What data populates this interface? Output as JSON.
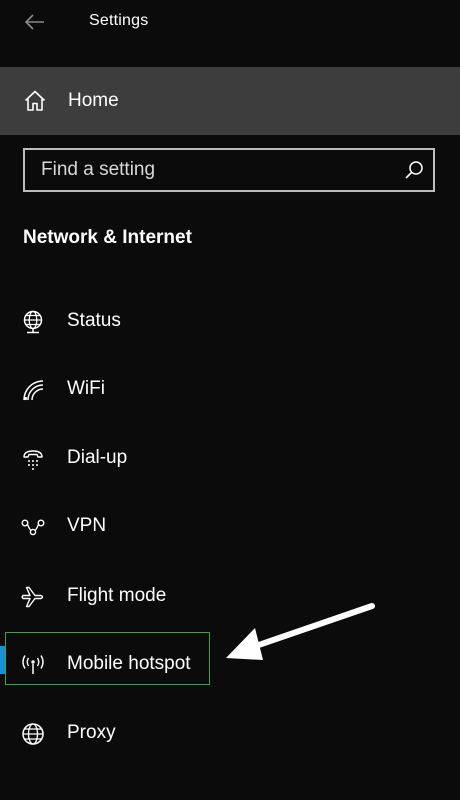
{
  "titlebar": {
    "title": "Settings",
    "back_icon": "back-arrow-icon"
  },
  "home": {
    "label": "Home",
    "icon": "home-icon"
  },
  "search": {
    "placeholder": "Find a setting",
    "value": "",
    "icon": "search-icon"
  },
  "section": {
    "heading": "Network & Internet"
  },
  "nav": {
    "items": [
      {
        "label": "Status",
        "icon": "globe-network-icon"
      },
      {
        "label": "WiFi",
        "icon": "wifi-icon"
      },
      {
        "label": "Dial-up",
        "icon": "dial-up-icon"
      },
      {
        "label": "VPN",
        "icon": "vpn-icon"
      },
      {
        "label": "Flight mode",
        "icon": "airplane-icon"
      },
      {
        "label": "Mobile hotspot",
        "icon": "hotspot-icon",
        "selected": true
      },
      {
        "label": "Proxy",
        "icon": "globe-icon"
      }
    ]
  },
  "colors": {
    "background": "#0b0b0b",
    "home_row": "#3d3d3d",
    "accent": "#1a8fd8",
    "focus_outline": "#2fa944",
    "annotation_arrow": "#ffffff"
  }
}
